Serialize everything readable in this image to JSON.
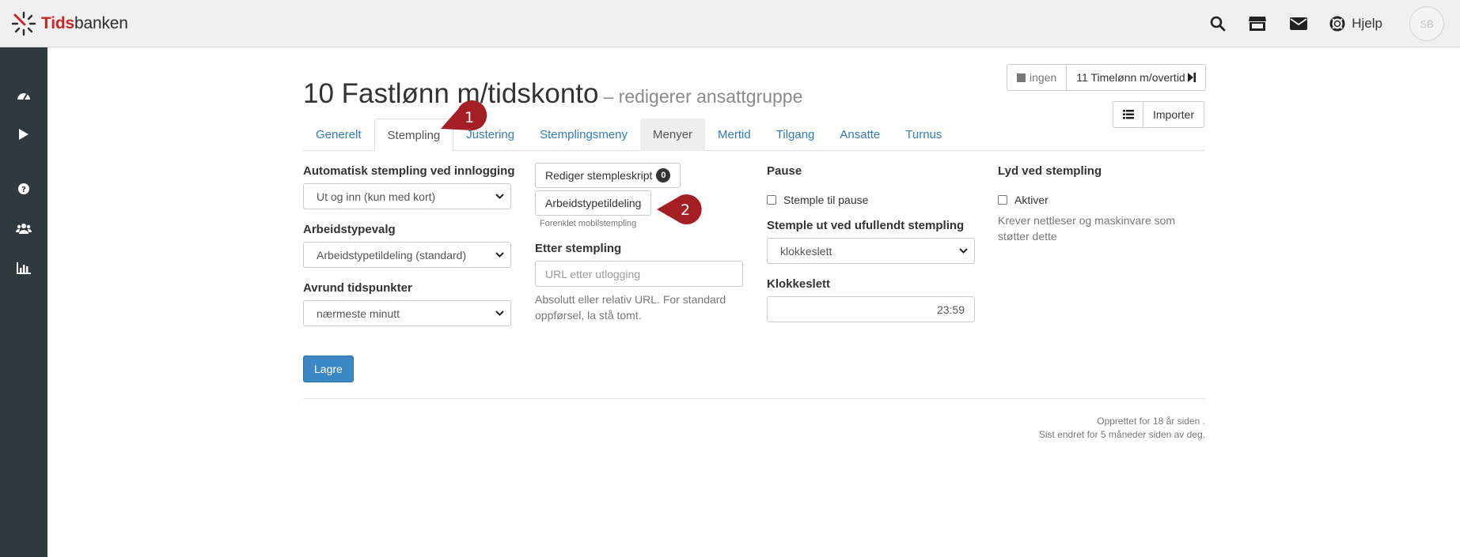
{
  "brand": {
    "name_part1": "Tids",
    "name_part2": "banken",
    "red": "#c8262b"
  },
  "topbar": {
    "icons": [
      "search-icon",
      "store-icon",
      "envelope-icon",
      "lifebuoy-icon"
    ],
    "help_label": "Hjelp",
    "avatar_initials": "SB"
  },
  "sidebar": {
    "items": [
      "dashboard-icon",
      "play-icon",
      "question-circle-icon",
      "users-icon",
      "bar-chart-icon"
    ]
  },
  "page": {
    "title": "10 Fastlønn m/tidskonto",
    "subtitle": "– redigerer ansattgruppe"
  },
  "nav_buttons": {
    "prev_label": "ingen",
    "next_label": "11 Timelønn m/overtid",
    "import_label": "Importer"
  },
  "tabs": [
    {
      "label": "Generelt",
      "state": "link"
    },
    {
      "label": "Stempling",
      "state": "active"
    },
    {
      "label": "Justering",
      "state": "link"
    },
    {
      "label": "Stemplingsmeny",
      "state": "link"
    },
    {
      "label": "Menyer",
      "state": "hover"
    },
    {
      "label": "Mertid",
      "state": "link"
    },
    {
      "label": "Tilgang",
      "state": "link"
    },
    {
      "label": "Ansatte",
      "state": "link"
    },
    {
      "label": "Turnus",
      "state": "link"
    }
  ],
  "col1": {
    "auto_label": "Automatisk stempling ved innlogging",
    "auto_value": "Ut og inn (kun med kort)",
    "worktype_label": "Arbeidstypevalg",
    "worktype_value": "Arbeidstypetildeling (standard)",
    "round_label": "Avrund tidspunkter",
    "round_value": "nærmeste minutt"
  },
  "col2": {
    "script_button": "Rediger stempleskript",
    "script_count": "0",
    "assign_button": "Arbeidstypetildeling",
    "assign_note": "Forenklet mobilstempling",
    "after_label": "Etter stempling",
    "after_placeholder": "URL etter utlogging",
    "after_help": "Absolutt eller relativ URL. For standard oppførsel, la stå tomt."
  },
  "col3": {
    "pause_label": "Pause",
    "pause_checkbox": "Stemple til pause",
    "out_label": "Stemple ut ved ufullendt stempling",
    "out_value": "klokkeslett",
    "clock_label": "Klokkeslett",
    "clock_value": "23:59"
  },
  "col4": {
    "sound_label": "Lyd ved stempling",
    "sound_checkbox": "Aktiver",
    "sound_help": "Krever nettleser og maskinvare som støtter dette"
  },
  "save_label": "Lagre",
  "footer": {
    "created": "Opprettet for 18 år siden .",
    "modified": "Sist endret for 5 måneder siden av deg."
  },
  "callouts": {
    "first": "1",
    "second": "2",
    "color": "#a31f24"
  },
  "colors": {
    "link": "#337ab7",
    "primary": "#3c87c5",
    "sidebar": "#2f3a3f"
  }
}
